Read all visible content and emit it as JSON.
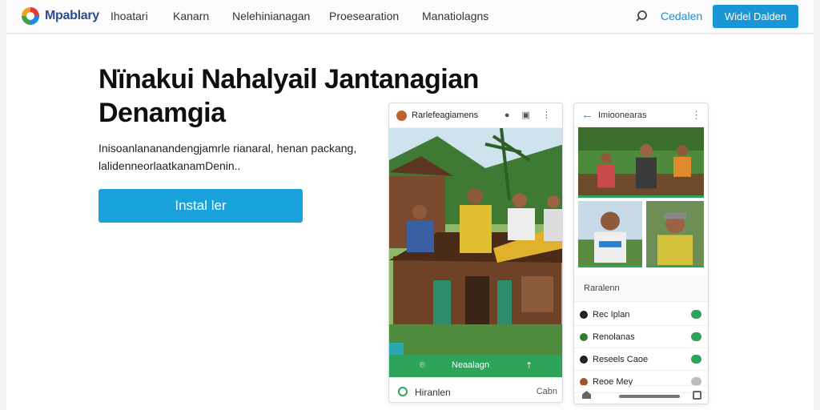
{
  "header": {
    "brand": "Mpablary",
    "nav": [
      "Ihoatari",
      "Kanarn",
      "Nelehinianagan",
      "Proesearation",
      "Manatiolagns"
    ],
    "login_label": "Cedalen",
    "cta_label": "Widel Dalden"
  },
  "hero": {
    "title": "Nïnakui Nahalyail Jantanagian Denamgia",
    "subtitle": "Inisoanlananandengjamrle rianaral, henan packang, lalidenneorlaatkanamDenin..",
    "button_label": "Instal ler"
  },
  "phone1": {
    "title": "Rarlefeagiamens",
    "bar_label": "Neaalagn",
    "bottom_left": "Hiranlen",
    "bottom_right": "Cabn"
  },
  "phone2": {
    "title": "Imioonearas",
    "section_label": "Raralenn",
    "list": [
      {
        "label": "Rec Iplan",
        "color": "#222222"
      },
      {
        "label": "Renolanas",
        "color": "#2e7d32"
      },
      {
        "label": "Reseels Caoe",
        "color": "#222222"
      },
      {
        "label": "Reoe Mey",
        "color": "#a0522d"
      }
    ]
  },
  "colors": {
    "accent": "#1a96d6",
    "green": "#2ea35a"
  }
}
